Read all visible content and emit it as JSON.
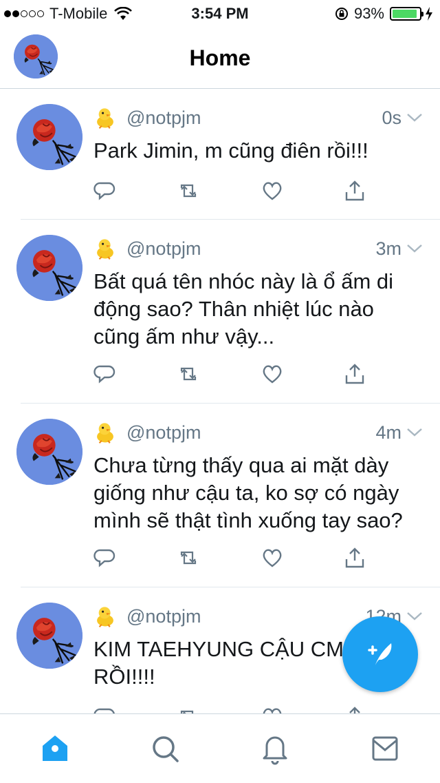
{
  "status_bar": {
    "signal_filled": 2,
    "signal_total": 5,
    "carrier": "T-Mobile",
    "time": "3:54 PM",
    "battery": "93%",
    "battery_level": 0.93,
    "battery_color": "#4cd964"
  },
  "navbar": {
    "title": "Home",
    "avatar_icon": "rose-avatar"
  },
  "tweets": [
    {
      "handle": "@notpjm",
      "time": "0s",
      "text": "Park Jimin, m cũng điên rồi!!!"
    },
    {
      "handle": "@notpjm",
      "time": "3m",
      "text": "Bất quá tên nhóc này là ổ ấm di động sao? Thân nhiệt lúc nào cũng ấm như vậy..."
    },
    {
      "handle": "@notpjm",
      "time": "4m",
      "text": "Chưa từng thấy qua ai mặt dày giống như cậu ta, ko sợ có ngày mình sẽ thật tình xuống tay sao?"
    },
    {
      "handle": "@notpjm",
      "time": "12m",
      "text": "KIM TAEHYUNG CẬU CM RỒI!!!!"
    }
  ],
  "icons": {
    "name_emoji": "baby-chick-icon",
    "actions": [
      "reply-icon",
      "retweet-icon",
      "like-icon",
      "share-icon"
    ],
    "compose": "compose-tweet-icon",
    "tabs": [
      "home-icon",
      "search-icon",
      "notifications-icon",
      "messages-icon"
    ]
  },
  "colors": {
    "accent": "#1da1f2",
    "muted": "#657786",
    "text": "#14171a",
    "divider": "#e1e8ed"
  },
  "tabbar": {
    "active": "home"
  }
}
